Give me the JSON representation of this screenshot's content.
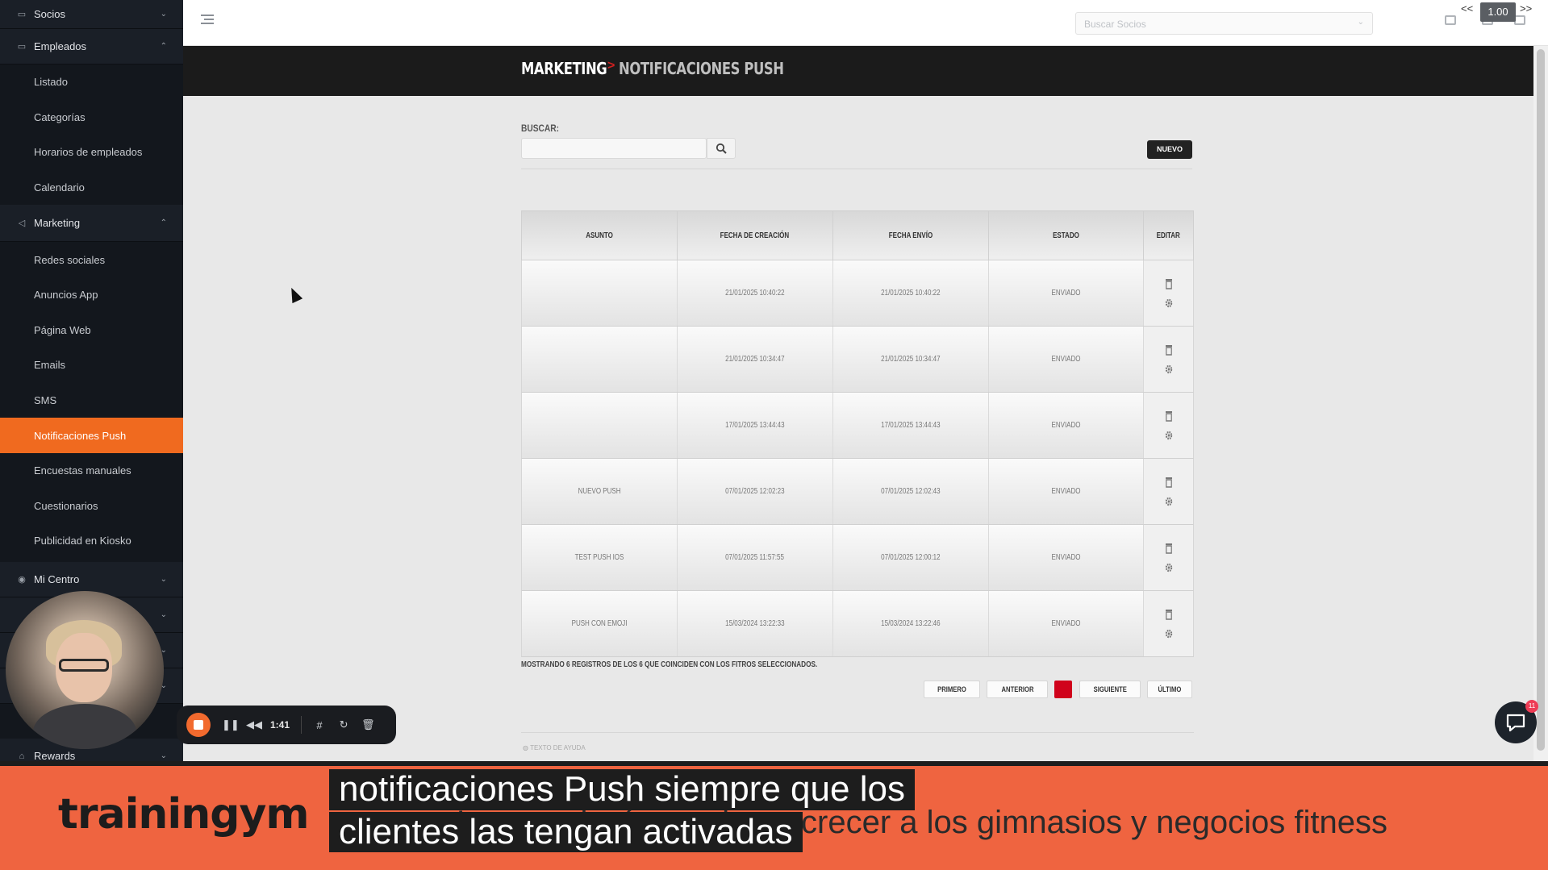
{
  "sidebar": {
    "groups": [
      {
        "label": "Socios",
        "icon": "id-card-icon",
        "expanded": false
      },
      {
        "label": "Empleados",
        "icon": "id-card-icon",
        "expanded": true,
        "items": [
          "Listado",
          "Categorías",
          "Horarios de empleados",
          "Calendario"
        ]
      },
      {
        "label": "Marketing",
        "icon": "megaphone-icon",
        "expanded": true,
        "items": [
          "Redes sociales",
          "Anuncios App",
          "Página Web",
          "Emails",
          "SMS",
          "Notificaciones Push",
          "Encuestas manuales",
          "Cuestionarios",
          "Publicidad en Kiosko"
        ]
      },
      {
        "label": "Mi Centro",
        "icon": "location-pin-icon",
        "expanded": false
      },
      {
        "label": "Rewards",
        "icon": "home-icon",
        "expanded": false
      }
    ],
    "active_item": "Notificaciones Push"
  },
  "topbar": {
    "search_placeholder": "Buscar Socios",
    "zoom_prev": "<<",
    "zoom_value": "1.00",
    "zoom_next": ">>"
  },
  "header": {
    "section": "MARKETING",
    "separator": ">",
    "page": "NOTIFICACIONES PUSH"
  },
  "search": {
    "label": "BUSCAR:",
    "value": "",
    "new_button": "NUEVO"
  },
  "table": {
    "columns": [
      "ASUNTO",
      "FECHA DE CREACIÓN",
      "FECHA ENVÍO",
      "ESTADO",
      "EDITAR"
    ],
    "rows": [
      {
        "asunto": "",
        "creacion": "21/01/2025 10:40:22",
        "envio": "21/01/2025 10:40:22",
        "estado": "ENVIADO"
      },
      {
        "asunto": "",
        "creacion": "21/01/2025 10:34:47",
        "envio": "21/01/2025 10:34:47",
        "estado": "ENVIADO"
      },
      {
        "asunto": "",
        "creacion": "17/01/2025 13:44:43",
        "envio": "17/01/2025 13:44:43",
        "estado": "ENVIADO"
      },
      {
        "asunto": "NUEVO PUSH",
        "creacion": "07/01/2025 12:02:23",
        "envio": "07/01/2025 12:02:43",
        "estado": "ENVIADO"
      },
      {
        "asunto": "TEST PUSH IOS",
        "creacion": "07/01/2025 11:57:55",
        "envio": "07/01/2025 12:00:12",
        "estado": "ENVIADO"
      },
      {
        "asunto": "PUSH CON EMOJI",
        "creacion": "15/03/2024 13:22:33",
        "envio": "15/03/2024 13:22:46",
        "estado": "ENVIADO"
      }
    ],
    "summary": "MOSTRANDO 6 REGISTROS DE LOS 6 QUE COINCIDEN CON LOS FITROS SELECCIONADOS."
  },
  "pagination": {
    "first": "PRIMERO",
    "prev": "ANTERIOR",
    "next": "SIGUIENTE",
    "last": "ÚLTIMO",
    "current_color": "#d0021b"
  },
  "help_text": "TEXTO DE AYUDA",
  "recorder": {
    "time": "1:41"
  },
  "chat": {
    "badge": "11"
  },
  "banner": {
    "brand": "trainingym",
    "tagline": "La tecnología que hace crecer a los gimnasios y negocios fitness",
    "caption_line1": "notificaciones Push siempre que los",
    "caption_line2": "clientes las tengan activadas"
  },
  "colors": {
    "accent": "#f06a1f",
    "sidebar_bg": "#13171d",
    "banner_bg": "#ef6440"
  }
}
